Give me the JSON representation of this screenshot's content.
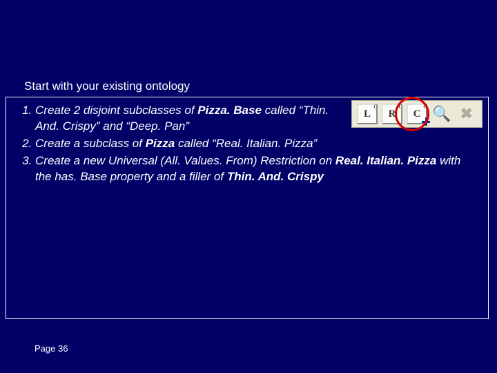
{
  "intro": "Start with your existing ontology",
  "toolbar": {
    "buttons": [
      {
        "key": "left",
        "letter": "L",
        "badge": "C"
      },
      {
        "key": "right",
        "letter": "R",
        "badge": "C",
        "highlighted": true
      },
      {
        "key": "class",
        "letter": "C",
        "badge": "C",
        "plus": true
      }
    ],
    "embossed": [
      {
        "key": "search",
        "glyph": "🔍"
      },
      {
        "key": "close",
        "glyph": "✖"
      }
    ]
  },
  "steps": [
    {
      "parts": [
        {
          "t": "Create 2 disjoint subclasses of "
        },
        {
          "t": "Pizza. Base",
          "bold": true
        },
        {
          "t": " called “Thin. And. Crispy” and “Deep. Pan”"
        }
      ],
      "wrapForToolbar": true
    },
    {
      "parts": [
        {
          "t": "Create a subclass of "
        },
        {
          "t": "Pizza",
          "bold": true
        },
        {
          "t": " called “Real. Italian. Pizza”"
        }
      ]
    },
    {
      "parts": [
        {
          "t": "Create a new Universal (All. Values. From) Restriction on "
        },
        {
          "t": "Real. Italian. Pizza",
          "bold": true
        },
        {
          "t": " with the has. Base property and a filler of "
        },
        {
          "t": "Thin. And. Crispy",
          "bold": true
        }
      ]
    }
  ],
  "footer": "Page 36"
}
